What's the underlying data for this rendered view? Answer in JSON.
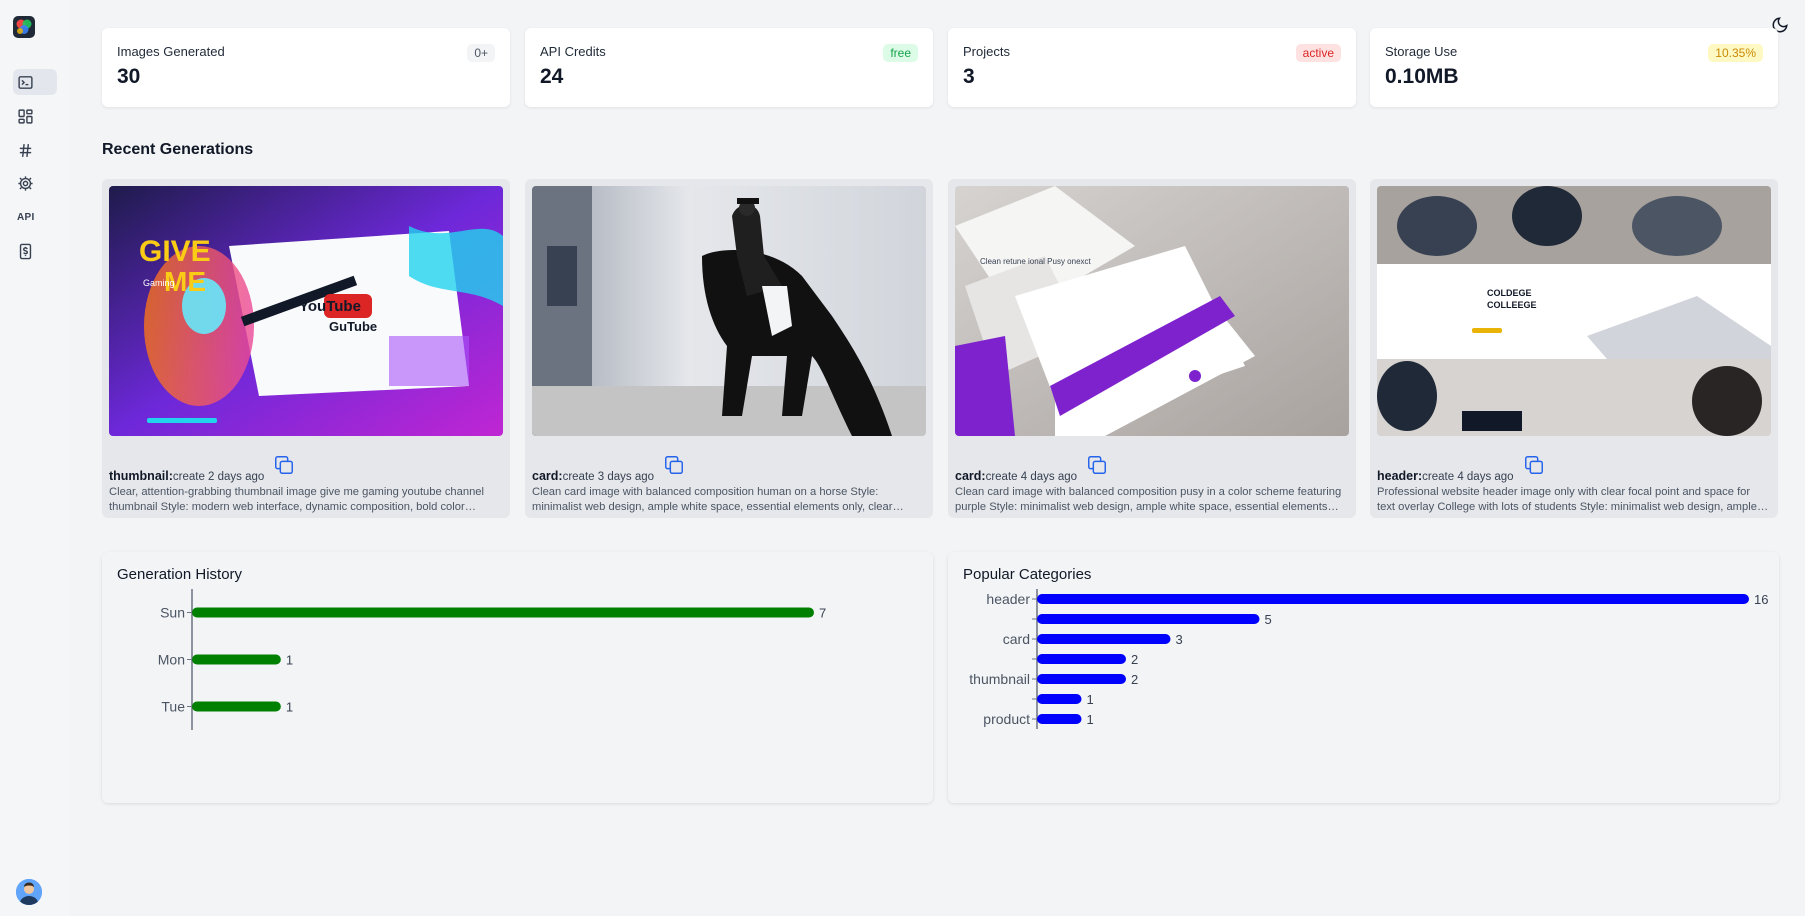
{
  "sidebar": {
    "items": [
      {
        "name": "terminal",
        "active": true
      },
      {
        "name": "dashboard",
        "active": false
      },
      {
        "name": "hash",
        "active": false
      },
      {
        "name": "settings",
        "active": false
      },
      {
        "name": "api",
        "label": "API",
        "active": false
      },
      {
        "name": "billing",
        "active": false
      }
    ]
  },
  "stats": [
    {
      "label": "Images Generated",
      "value": "30",
      "badge": "0+",
      "badge_bg": "#f3f4f6",
      "badge_color": "#4b5563"
    },
    {
      "label": "API Credits",
      "value": "24",
      "badge": "free",
      "badge_bg": "#dcfce7",
      "badge_color": "#16a34a"
    },
    {
      "label": "Projects",
      "value": "3",
      "badge": "active",
      "badge_bg": "#fee2e2",
      "badge_color": "#dc2626"
    },
    {
      "label": "Storage Use",
      "value": "0.10MB",
      "badge": "10.35%",
      "badge_bg": "#fef9c3",
      "badge_color": "#ca8a04"
    }
  ],
  "recent": {
    "title": "Recent Generations",
    "items": [
      {
        "type": "thumbnail:",
        "time": "create 2 days ago",
        "desc": "Clear, attention-grabbing thumbnail image give me gaming youtube channel thumbnail Style: modern web interface, dynamic composition, bold color scheme"
      },
      {
        "type": "card:",
        "time": "create 3 days ago",
        "desc": "Clean card image with balanced composition human on a horse Style: minimalist web design, ample white space, essential elements only, clear hierarchy"
      },
      {
        "type": "card:",
        "time": "create 4 days ago",
        "desc": "Clean card image with balanced composition pusy in a color scheme featuring purple Style: minimalist web design, ample white space, essential elements only"
      },
      {
        "type": "header:",
        "time": "create 4 days ago",
        "desc": "Professional website header image only with clear focal point and space for text overlay College with lots of students Style: minimalist web design, ample white space"
      }
    ],
    "image_text": {
      "give": "GIVE",
      "me": "ME",
      "youtube": "YouTube",
      "gutube": "GuTube",
      "gaming": "Gaming",
      "college_1": "COLDEGE",
      "college_2": "COLLEEGE",
      "purple_card": "Clean retune ional Pusy onexct"
    }
  },
  "charts": {
    "history_title": "Generation History",
    "categories_title": "Popular Categories"
  },
  "chart_data": [
    {
      "type": "bar",
      "title": "Generation History",
      "orientation": "horizontal",
      "categories": [
        "Sun",
        "Mon",
        "Tue"
      ],
      "values": [
        7,
        1,
        1
      ],
      "color": "#008000",
      "xlim": [
        0,
        7
      ]
    },
    {
      "type": "bar",
      "title": "Popular Categories",
      "orientation": "horizontal",
      "categories": [
        "header",
        "",
        "card",
        "",
        "thumbnail",
        "",
        "product"
      ],
      "values": [
        16,
        5,
        3,
        2,
        2,
        1,
        1
      ],
      "color": "#0000ff",
      "xlim": [
        0,
        16
      ]
    }
  ]
}
